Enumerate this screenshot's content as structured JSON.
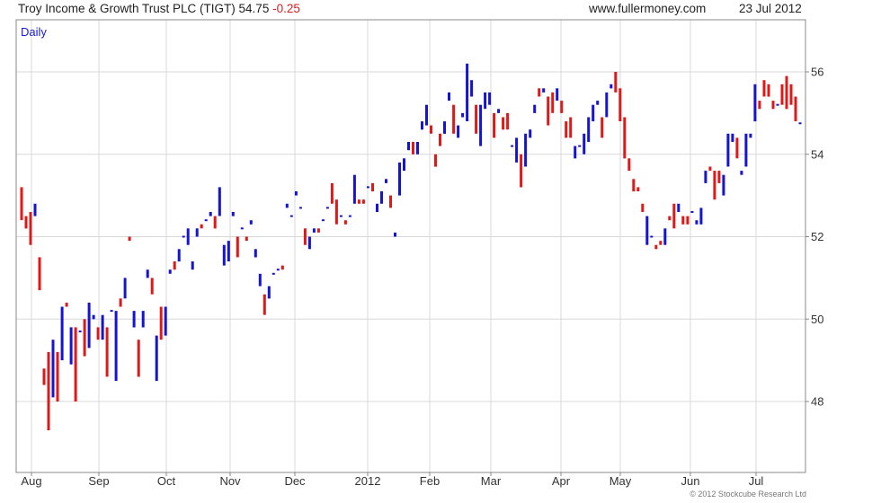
{
  "header": {
    "title": "Troy Income & Growth Trust PLC (TIGT) 54.75",
    "change": "-0.25",
    "site": "www.fullermoney.com",
    "date": "23 Jul 2012"
  },
  "period_label": "Daily",
  "copyright": "© 2012 Stockcube Research Ltd",
  "colors": {
    "up": "#1414d2",
    "down": "#e01818",
    "grid": "#d8d8d8",
    "frame": "#888888"
  },
  "chart_data": {
    "type": "ohlc-bar",
    "title": "Troy Income & Growth Trust PLC (TIGT) 54.75 -0.25",
    "y_axis": {
      "side": "right",
      "ylim": [
        46.3,
        57.2
      ],
      "ticks": [
        48,
        50,
        52,
        54,
        56
      ]
    },
    "x_axis": {
      "labels": [
        "Aug",
        "Sep",
        "Oct",
        "Nov",
        "Dec",
        "2012",
        "Feb",
        "Mar",
        "Apr",
        "May",
        "Jun",
        "Jul"
      ]
    },
    "grid": true,
    "bars": [
      [
        53.2,
        52.4
      ],
      [
        52.5,
        52.2
      ],
      [
        52.6,
        51.8
      ],
      [
        52.5,
        52.8
      ],
      [
        51.5,
        50.7
      ],
      [
        48.8,
        48.4
      ],
      [
        49.2,
        47.3
      ],
      [
        48.1,
        49.5
      ],
      [
        49.2,
        48.0
      ],
      [
        49.0,
        50.3
      ],
      [
        50.4,
        50.3
      ],
      [
        48.9,
        49.8
      ],
      [
        49.8,
        48.0
      ],
      [
        49.7,
        49.7
      ],
      [
        50.0,
        49.1
      ],
      [
        49.3,
        50.4
      ],
      [
        50.0,
        50.1
      ],
      [
        49.8,
        49.5
      ],
      [
        49.5,
        50.1
      ],
      [
        49.8,
        48.6
      ],
      [
        50.2,
        50.2
      ],
      [
        48.5,
        50.2
      ],
      [
        50.5,
        50.3
      ],
      [
        50.5,
        51.0
      ],
      [
        52.0,
        51.9
      ],
      [
        49.8,
        50.2
      ],
      [
        49.5,
        48.6
      ],
      [
        49.8,
        50.2
      ],
      [
        51.0,
        51.2
      ],
      [
        51.0,
        50.6
      ],
      [
        48.5,
        49.6
      ],
      [
        50.3,
        49.5
      ],
      [
        49.6,
        50.3
      ],
      [
        51.1,
        51.2
      ],
      [
        51.4,
        51.2
      ],
      [
        51.4,
        51.7
      ],
      [
        52.0,
        52.0
      ],
      [
        51.8,
        52.2
      ],
      [
        51.2,
        51.4
      ],
      [
        52.0,
        52.2
      ],
      [
        52.3,
        52.2
      ],
      [
        52.4,
        52.4
      ],
      [
        52.5,
        52.6
      ],
      [
        52.5,
        52.2
      ],
      [
        52.5,
        53.2
      ],
      [
        51.3,
        51.8
      ],
      [
        51.4,
        51.9
      ],
      [
        52.5,
        52.6
      ],
      [
        52.0,
        51.5
      ],
      [
        52.2,
        52.2
      ],
      [
        52.0,
        51.9
      ],
      [
        52.3,
        52.4
      ],
      [
        51.5,
        51.7
      ],
      [
        50.8,
        51.1
      ],
      [
        50.6,
        50.1
      ],
      [
        50.5,
        50.8
      ],
      [
        51.1,
        51.1
      ],
      [
        51.2,
        51.2
      ],
      [
        51.3,
        51.2
      ],
      [
        52.7,
        52.8
      ],
      [
        52.5,
        52.5
      ],
      [
        53.0,
        53.1
      ],
      [
        52.7,
        52.7
      ],
      [
        52.2,
        51.8
      ],
      [
        51.7,
        52.0
      ],
      [
        52.1,
        52.2
      ],
      [
        52.2,
        52.1
      ],
      [
        52.4,
        52.4
      ],
      [
        52.7,
        52.7
      ],
      [
        53.3,
        52.8
      ],
      [
        52.9,
        52.3
      ],
      [
        52.5,
        52.5
      ],
      [
        52.4,
        52.3
      ],
      [
        52.5,
        52.5
      ],
      [
        52.8,
        53.5
      ],
      [
        52.9,
        52.8
      ],
      [
        52.9,
        52.8
      ],
      [
        53.2,
        53.2
      ],
      [
        53.3,
        53.1
      ],
      [
        52.6,
        52.8
      ],
      [
        52.8,
        53.1
      ],
      [
        53.3,
        53.4
      ],
      [
        53.0,
        52.7
      ],
      [
        52.0,
        52.1
      ],
      [
        53.0,
        53.8
      ],
      [
        53.6,
        53.9
      ],
      [
        54.1,
        54.3
      ],
      [
        54.3,
        54.0
      ],
      [
        54.0,
        54.3
      ],
      [
        54.6,
        54.8
      ],
      [
        54.7,
        55.2
      ],
      [
        54.7,
        54.5
      ],
      [
        54.0,
        53.7
      ],
      [
        54.5,
        54.2
      ],
      [
        54.5,
        54.8
      ],
      [
        55.3,
        55.5
      ],
      [
        55.2,
        54.5
      ],
      [
        54.4,
        54.7
      ],
      [
        54.9,
        55.0
      ],
      [
        54.8,
        56.2
      ],
      [
        55.4,
        55.8
      ],
      [
        55.2,
        54.5
      ],
      [
        54.2,
        55.2
      ],
      [
        55.1,
        55.5
      ],
      [
        55.2,
        55.5
      ],
      [
        55.0,
        54.4
      ],
      [
        55.0,
        55.1
      ],
      [
        54.9,
        54.6
      ],
      [
        55.0,
        54.6
      ],
      [
        54.2,
        54.2
      ],
      [
        53.8,
        54.4
      ],
      [
        54.0,
        53.2
      ],
      [
        53.7,
        54.5
      ],
      [
        54.4,
        54.6
      ],
      [
        55.0,
        55.2
      ],
      [
        55.6,
        55.4
      ],
      [
        55.5,
        55.6
      ],
      [
        55.4,
        54.7
      ],
      [
        55.5,
        55.0
      ],
      [
        55.3,
        55.6
      ],
      [
        55.3,
        55.0
      ],
      [
        54.8,
        54.4
      ],
      [
        54.9,
        54.4
      ],
      [
        53.9,
        54.2
      ],
      [
        54.2,
        54.2
      ],
      [
        54.0,
        54.5
      ],
      [
        54.3,
        54.9
      ],
      [
        54.8,
        55.2
      ],
      [
        55.2,
        55.3
      ],
      [
        54.9,
        54.4
      ],
      [
        54.9,
        55.5
      ],
      [
        55.6,
        55.7
      ],
      [
        56.0,
        55.5
      ],
      [
        55.6,
        54.8
      ],
      [
        54.9,
        53.9
      ],
      [
        53.9,
        53.6
      ],
      [
        53.4,
        53.1
      ],
      [
        53.2,
        53.1
      ],
      [
        52.8,
        52.6
      ],
      [
        51.8,
        52.5
      ],
      [
        52.0,
        52.0
      ],
      [
        51.8,
        51.7
      ],
      [
        51.9,
        51.8
      ],
      [
        51.8,
        52.2
      ],
      [
        52.5,
        52.4
      ],
      [
        52.8,
        52.2
      ],
      [
        52.6,
        52.8
      ],
      [
        52.5,
        52.3
      ],
      [
        52.5,
        52.3
      ],
      [
        52.6,
        52.6
      ],
      [
        52.3,
        52.4
      ],
      [
        52.3,
        52.7
      ],
      [
        53.3,
        53.6
      ],
      [
        53.7,
        53.6
      ],
      [
        53.6,
        52.9
      ],
      [
        53.6,
        53.3
      ],
      [
        53.0,
        53.5
      ],
      [
        53.7,
        54.5
      ],
      [
        54.3,
        54.5
      ],
      [
        54.4,
        53.9
      ],
      [
        53.5,
        53.6
      ],
      [
        53.7,
        54.5
      ],
      [
        54.4,
        54.5
      ],
      [
        54.8,
        55.7
      ],
      [
        55.3,
        55.1
      ],
      [
        55.8,
        55.4
      ],
      [
        55.7,
        55.4
      ],
      [
        55.3,
        55.1
      ],
      [
        55.2,
        55.2
      ],
      [
        55.7,
        55.2
      ],
      [
        55.9,
        55.1
      ],
      [
        55.7,
        55.2
      ],
      [
        55.4,
        54.8
      ],
      [
        54.75,
        54.75
      ]
    ]
  }
}
